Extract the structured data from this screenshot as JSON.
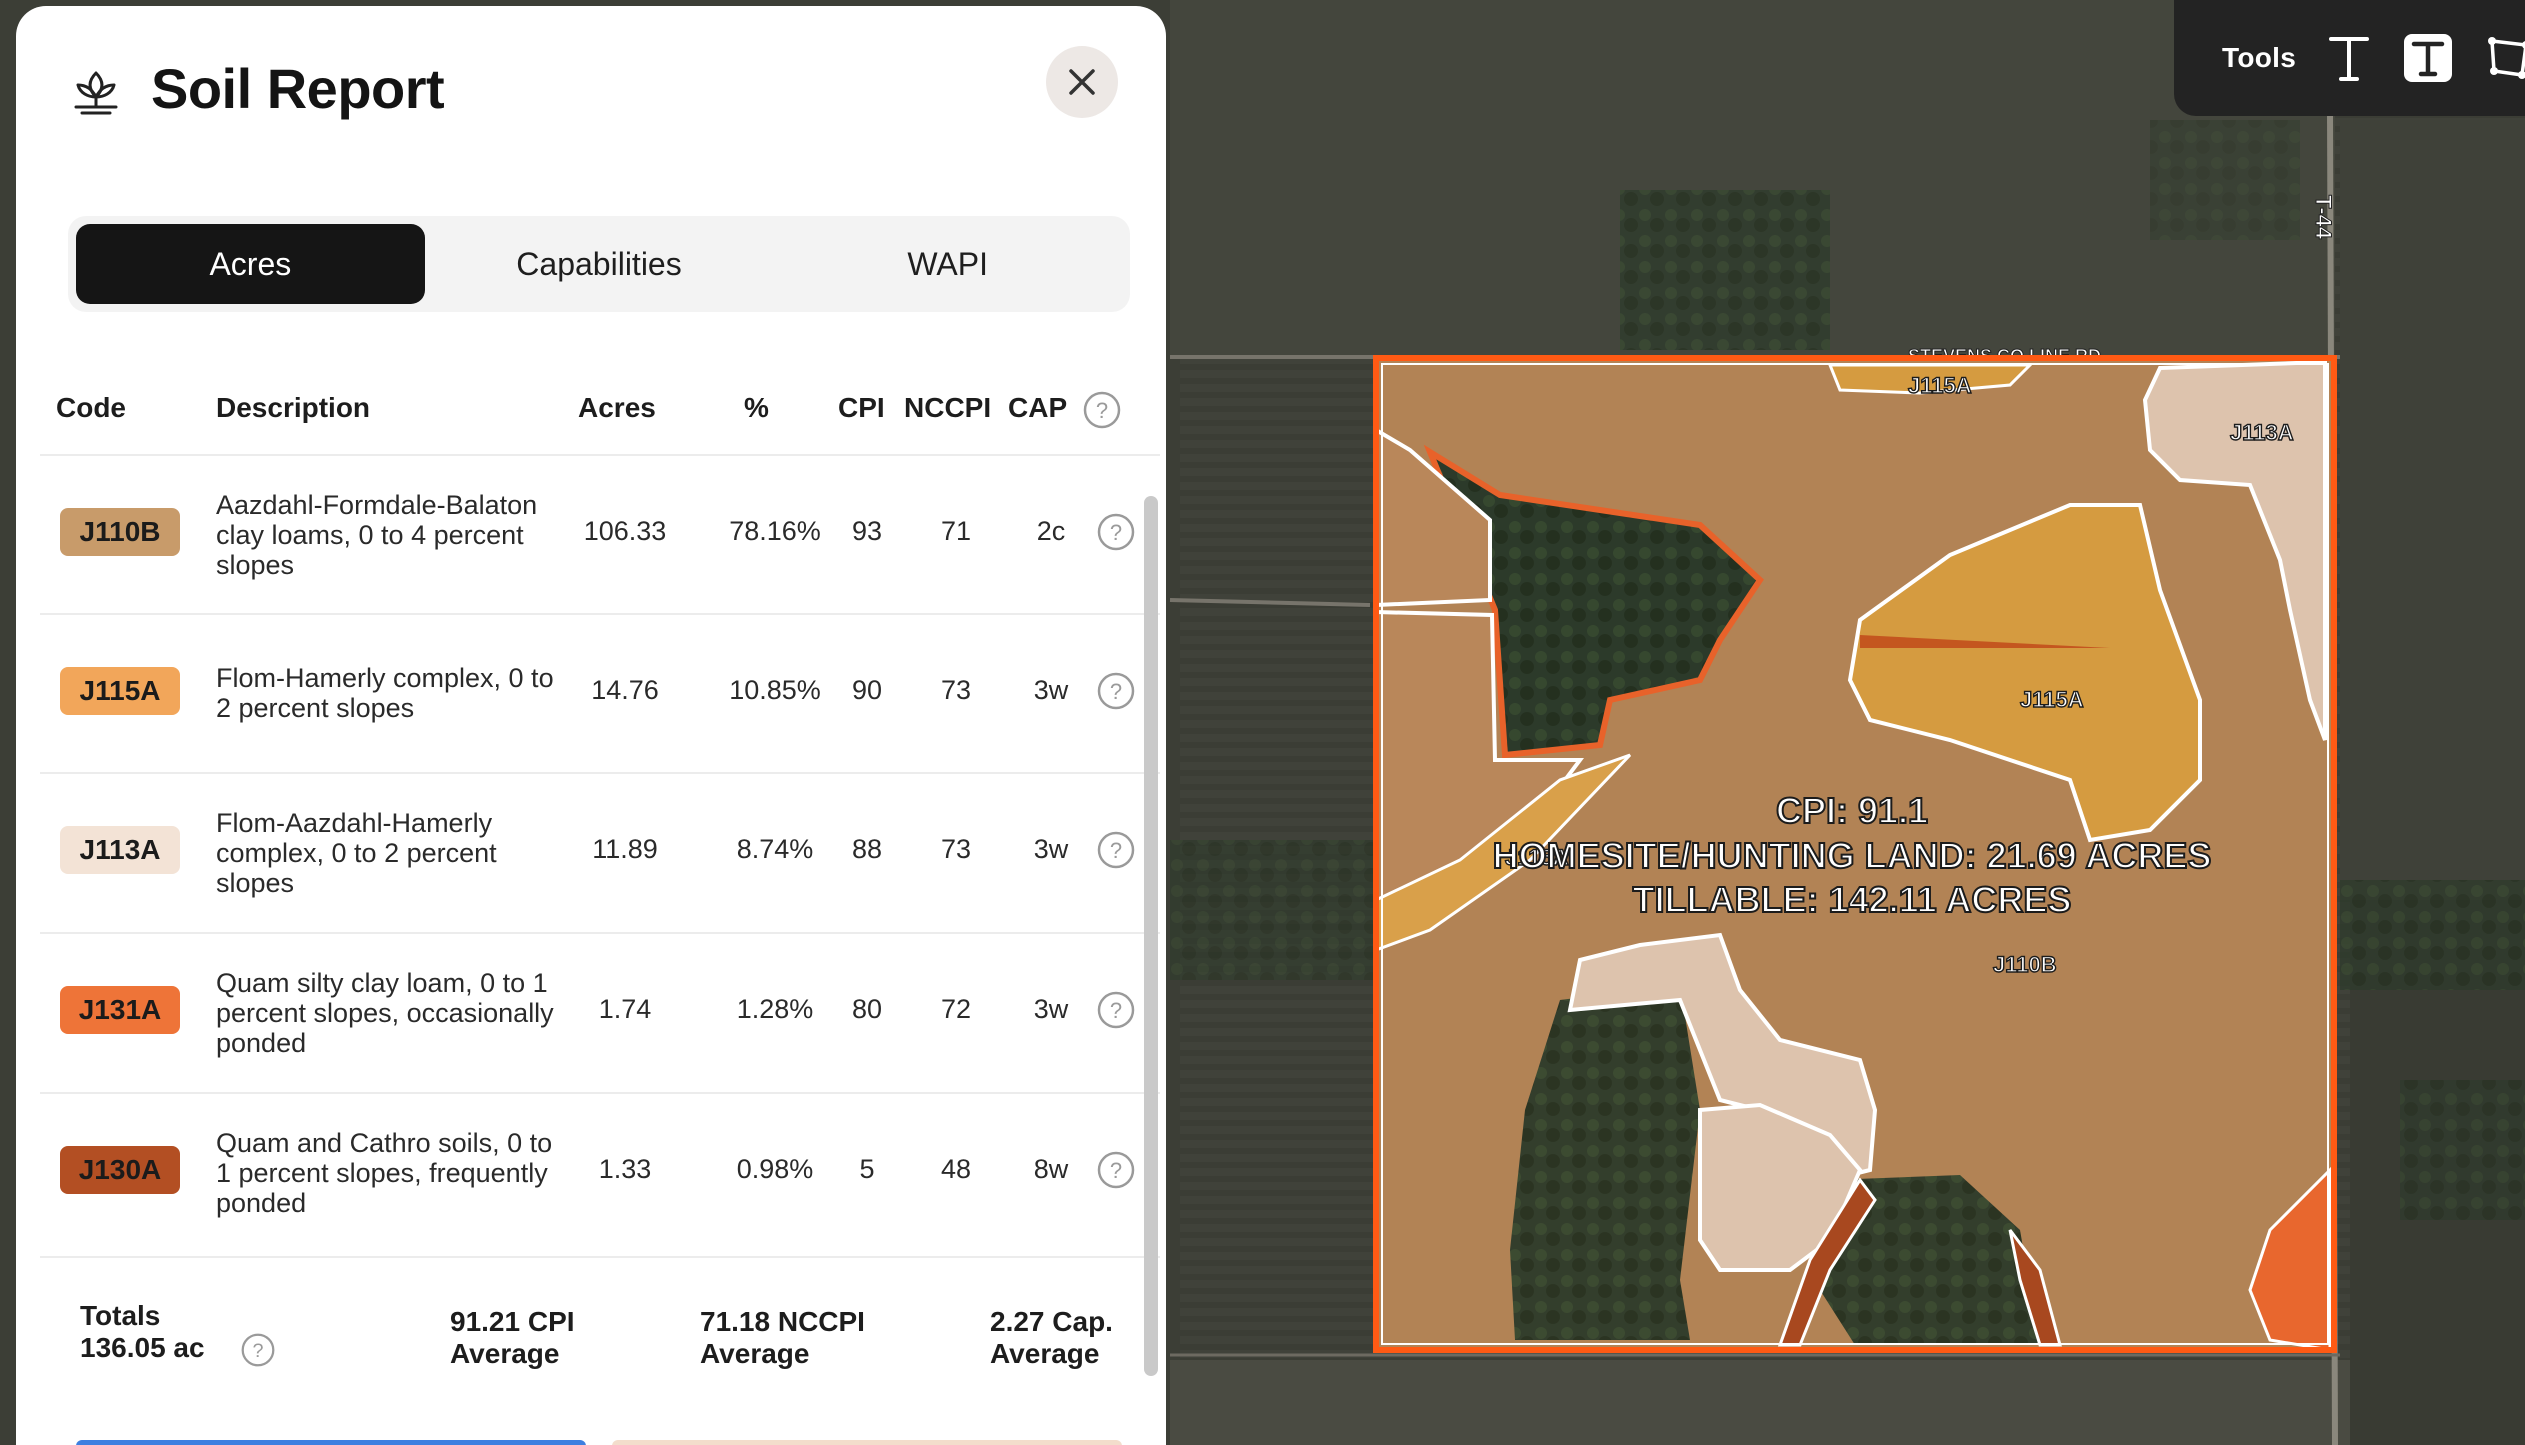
{
  "panel": {
    "title": "Soil Report",
    "icon": "plant-sprout-icon",
    "close_icon": "close-icon"
  },
  "tabs": [
    {
      "label": "Acres",
      "active": true
    },
    {
      "label": "Capabilities",
      "active": false
    },
    {
      "label": "WAPI",
      "active": false
    }
  ],
  "table": {
    "headers": {
      "code": "Code",
      "description": "Description",
      "acres": "Acres",
      "percent": "%",
      "cpi": "CPI",
      "nccpi": "NCCPI",
      "cap": "CAP"
    },
    "rows": [
      {
        "code": "J110B",
        "color": "#c89b6a",
        "description": "Aazdahl-Formdale-Balaton clay loams, 0 to 4 percent slopes",
        "acres": "106.33",
        "percent": "78.16%",
        "cpi": "93",
        "nccpi": "71",
        "cap": "2c"
      },
      {
        "code": "J115A",
        "color": "#f2a65a",
        "description": "Flom-Hamerly complex, 0 to 2 percent slopes",
        "acres": "14.76",
        "percent": "10.85%",
        "cpi": "90",
        "nccpi": "73",
        "cap": "3w"
      },
      {
        "code": "J113A",
        "color": "#f3e3d6",
        "description": "Flom-Aazdahl-Hamerly complex, 0 to 2 percent slopes",
        "acres": "11.89",
        "percent": "8.74%",
        "cpi": "88",
        "nccpi": "73",
        "cap": "3w"
      },
      {
        "code": "J131A",
        "color": "#ee7438",
        "description": "Quam silty clay loam, 0 to 1 percent slopes, occasionally ponded",
        "acres": "1.74",
        "percent": "1.28%",
        "cpi": "80",
        "nccpi": "72",
        "cap": "3w"
      },
      {
        "code": "J130A",
        "color": "#b34f23",
        "description": "Quam and Cathro soils, 0 to 1 percent slopes, frequently ponded",
        "acres": "1.33",
        "percent": "0.98%",
        "cpi": "5",
        "nccpi": "48",
        "cap": "8w"
      }
    ]
  },
  "totals": {
    "label": "Totals",
    "acres": "136.05 ac",
    "cpi_value": "91.21 CPI",
    "cpi_caption": "Average",
    "nccpi_value": "71.18 NCCPI",
    "nccpi_caption": "Average",
    "cap_value": "2.27 Cap.",
    "cap_caption": "Average"
  },
  "tools": {
    "label": "Tools",
    "items": [
      "text-tool-icon",
      "text-box-tool-icon",
      "polygon-tool-icon"
    ]
  },
  "map": {
    "road_label_top": "STEVENS CO LINE RD",
    "road_label_right": "T-44",
    "overlay_lines": [
      "CPI: 91.1",
      "HOMESITE/HUNTING LAND: 21.69 ACRES",
      "TILLABLE: 142.11 ACRES"
    ],
    "zone_labels": [
      "J115A",
      "J113A",
      "J115A",
      "J115A",
      "J110B"
    ]
  }
}
